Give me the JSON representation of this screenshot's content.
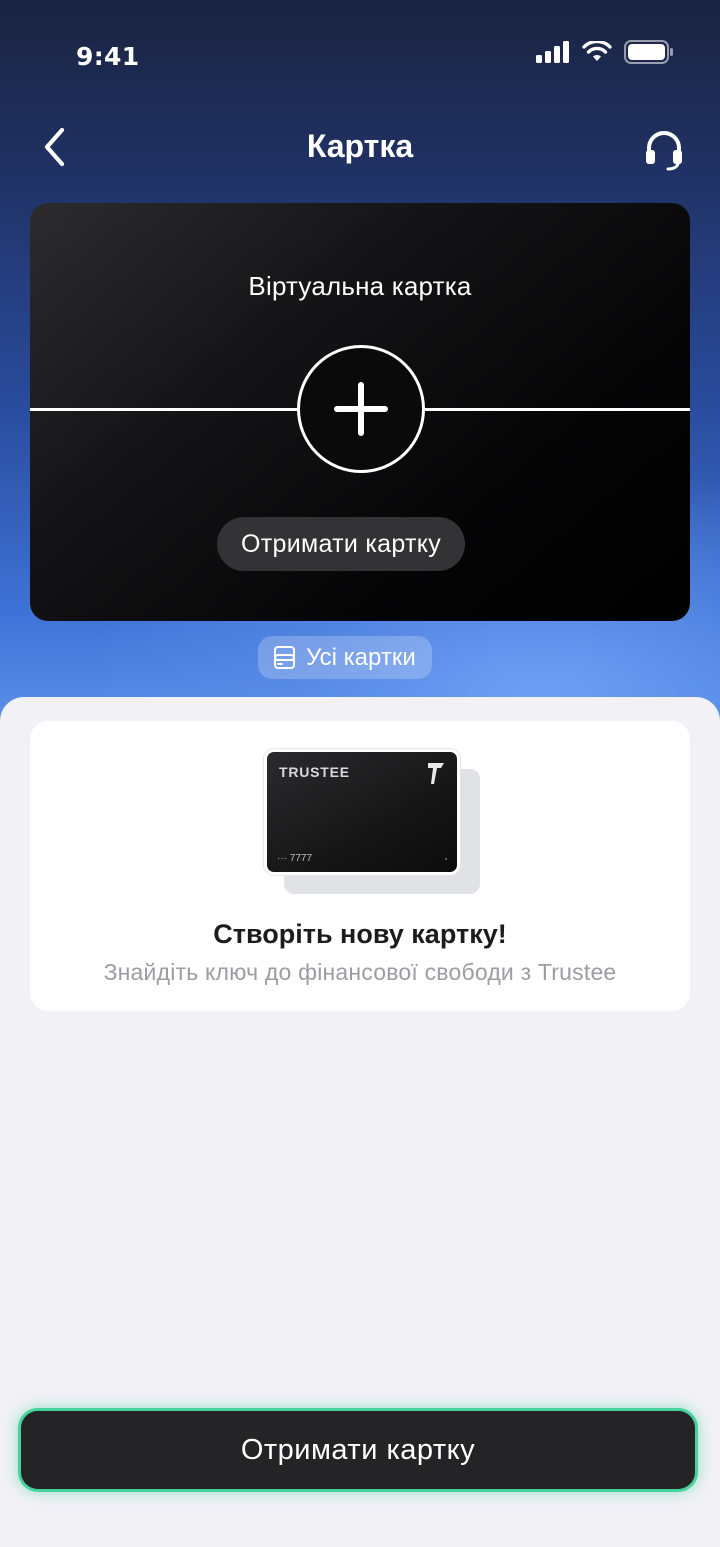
{
  "status_bar": {
    "time": "9:41"
  },
  "nav": {
    "title": "Картка",
    "back_icon": "chevron-left-icon",
    "support_icon": "headset-icon"
  },
  "virtual_card": {
    "title": "Віртуальна картка",
    "add_icon": "plus-icon",
    "get_button_label": "Отримати картку"
  },
  "all_cards": {
    "label": "Усі картки",
    "icon": "cards-icon"
  },
  "promo": {
    "card_brand": "TRUSTEE",
    "card_number": "··· 7777",
    "title": "Створіть нову картку!",
    "subtitle": "Знайдіть ключ до фінансової свободи з Trustee"
  },
  "cta": {
    "label": "Отримати картку"
  },
  "colors": {
    "accent_glow": "#46d29c",
    "cta_bg": "#242426",
    "sheet_bg": "#f1f1f6"
  }
}
